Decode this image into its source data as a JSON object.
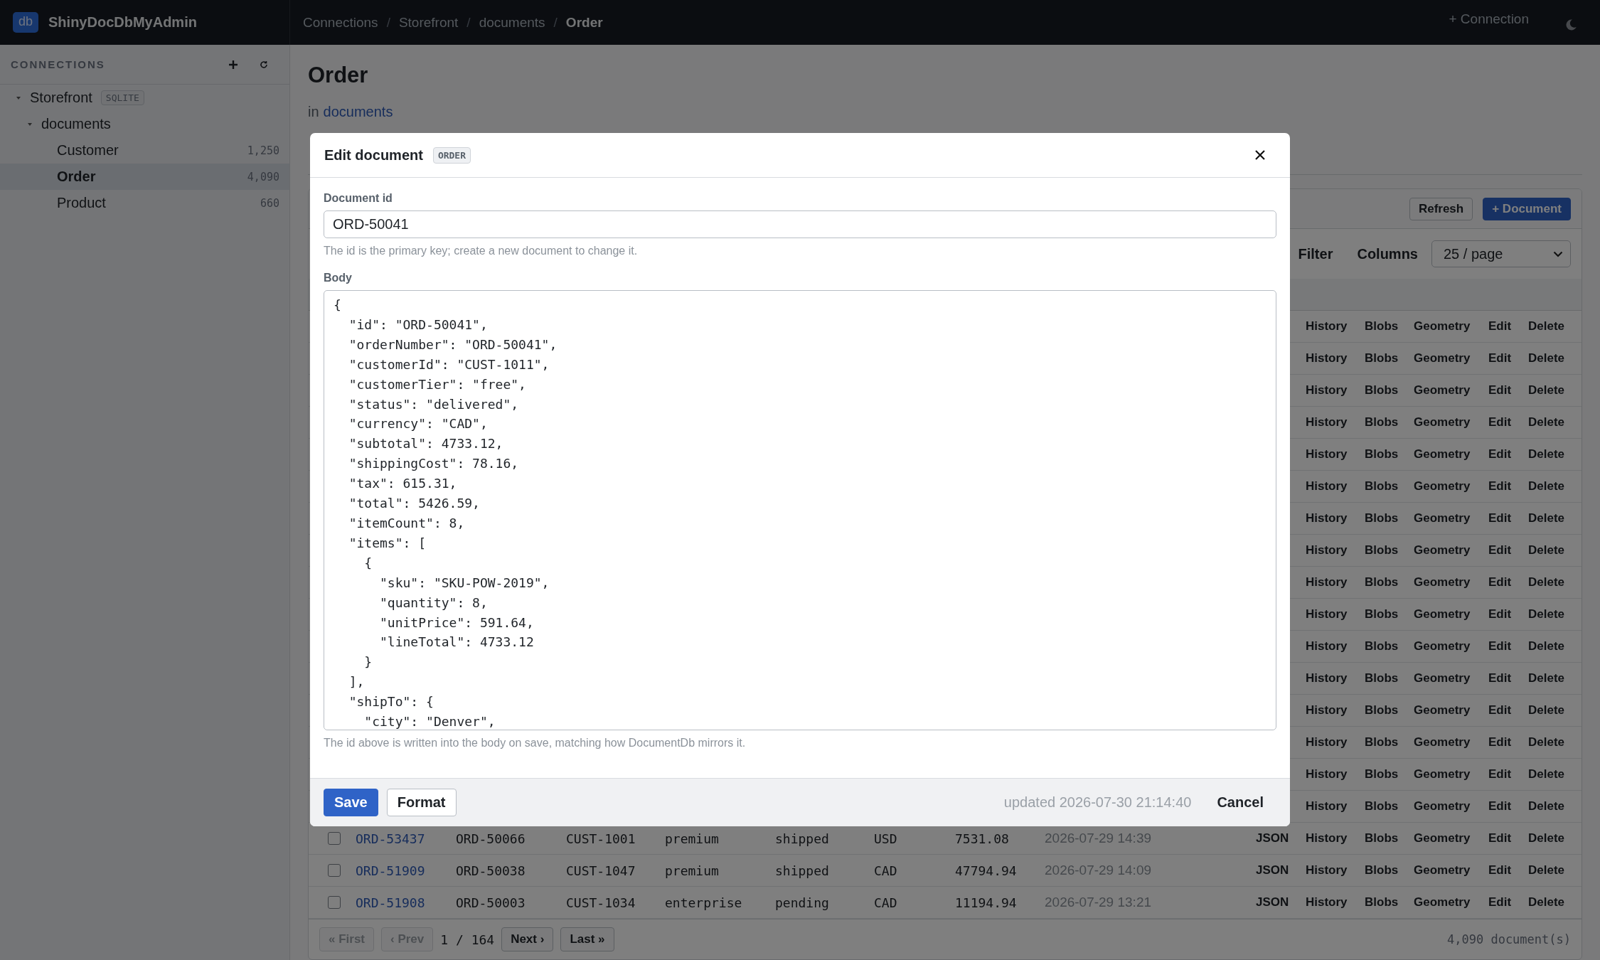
{
  "app": {
    "logo": "db",
    "name": "ShinyDocDbMyAdmin"
  },
  "breadcrumb": [
    {
      "label": "Connections",
      "current": false
    },
    {
      "label": "Storefront",
      "current": false
    },
    {
      "label": "documents",
      "current": false
    },
    {
      "label": "Order",
      "current": true
    }
  ],
  "breadcrumb_separator": "/",
  "topbar": {
    "new_connection": "+ Connection"
  },
  "sidebar": {
    "title": "CONNECTIONS",
    "tree": [
      {
        "name": "Storefront",
        "badge": "SQLITE",
        "expanded": true,
        "selected": false,
        "children": [
          {
            "name": "documents",
            "expanded": true,
            "selected": false,
            "children": [
              {
                "name": "Customer",
                "count": "1,250",
                "selected": false
              },
              {
                "name": "Order",
                "count": "4,090",
                "selected": true
              },
              {
                "name": "Product",
                "count": "660",
                "selected": false
              }
            ]
          }
        ]
      }
    ]
  },
  "page": {
    "title": "Order",
    "context_prefix": "in",
    "context_link": "documents"
  },
  "toolbar": {
    "buttons": [
      {
        "label": "Refresh",
        "kind": "secondary"
      },
      {
        "label": "+ Document",
        "kind": "primary"
      }
    ]
  },
  "filter_bar": {
    "filter": "Filter",
    "columns": "Columns",
    "page_size": "25 / page"
  },
  "table": {
    "rows": [
      {
        "actions": [
          "History",
          "Blobs",
          "Geometry",
          "Edit",
          "Delete"
        ]
      },
      {
        "actions": [
          "History",
          "Blobs",
          "Geometry",
          "Edit",
          "Delete"
        ]
      },
      {
        "actions": [
          "History",
          "Blobs",
          "Geometry",
          "Edit",
          "Delete"
        ]
      },
      {
        "actions": [
          "History",
          "Blobs",
          "Geometry",
          "Edit",
          "Delete"
        ]
      },
      {
        "actions": [
          "History",
          "Blobs",
          "Geometry",
          "Edit",
          "Delete"
        ]
      },
      {
        "actions": [
          "History",
          "Blobs",
          "Geometry",
          "Edit",
          "Delete"
        ]
      },
      {
        "actions": [
          "History",
          "Blobs",
          "Geometry",
          "Edit",
          "Delete"
        ]
      },
      {
        "actions": [
          "History",
          "Blobs",
          "Geometry",
          "Edit",
          "Delete"
        ]
      },
      {
        "actions": [
          "History",
          "Blobs",
          "Geometry",
          "Edit",
          "Delete"
        ]
      },
      {
        "actions": [
          "History",
          "Blobs",
          "Geometry",
          "Edit",
          "Delete"
        ]
      },
      {
        "actions": [
          "History",
          "Blobs",
          "Geometry",
          "Edit",
          "Delete"
        ]
      },
      {
        "actions": [
          "History",
          "Blobs",
          "Geometry",
          "Edit",
          "Delete"
        ]
      },
      {
        "actions": [
          "History",
          "Blobs",
          "Geometry",
          "Edit",
          "Delete"
        ]
      },
      {
        "actions": [
          "History",
          "Blobs",
          "Geometry",
          "Edit",
          "Delete"
        ]
      },
      {
        "actions": [
          "History",
          "Blobs",
          "Geometry",
          "Edit",
          "Delete"
        ]
      },
      {
        "actions": [
          "History",
          "Blobs",
          "Geometry",
          "Edit",
          "Delete"
        ]
      },
      {
        "checked": false,
        "cells": [
          "ORD-53437",
          "ORD-50066",
          "CUST-1001",
          "premium",
          "shipped",
          "USD",
          "7531.08",
          "2026-07-29 14:39"
        ],
        "actions": [
          "JSON",
          "History",
          "Blobs",
          "Geometry",
          "Edit",
          "Delete"
        ]
      },
      {
        "checked": false,
        "cells": [
          "ORD-51909",
          "ORD-50038",
          "CUST-1047",
          "premium",
          "shipped",
          "CAD",
          "47794.94",
          "2026-07-29 14:09"
        ],
        "actions": [
          "JSON",
          "History",
          "Blobs",
          "Geometry",
          "Edit",
          "Delete"
        ]
      },
      {
        "checked": false,
        "cells": [
          "ORD-51908",
          "ORD-50003",
          "CUST-1034",
          "enterprise",
          "pending",
          "CAD",
          "11194.94",
          "2026-07-29 13:21"
        ],
        "actions": [
          "JSON",
          "History",
          "Blobs",
          "Geometry",
          "Edit",
          "Delete"
        ]
      }
    ]
  },
  "pagination": {
    "controls": [
      {
        "kind": "button",
        "label": "« First",
        "disabled": true
      },
      {
        "kind": "button",
        "label": "‹ Prev",
        "disabled": true
      },
      {
        "kind": "text",
        "label": "1 / 164"
      },
      {
        "kind": "button",
        "label": "Next ›",
        "disabled": false
      },
      {
        "kind": "button",
        "label": "Last »",
        "disabled": false
      }
    ],
    "count": "4,090 document(s)"
  },
  "modal": {
    "title": "Edit document",
    "tag": "ORDER",
    "id_label": "Document id",
    "id_value": "ORD-50041",
    "id_help": "The id is the primary key; create a new document to change it.",
    "body_label": "Body",
    "body_value": "{\n  \"id\": \"ORD-50041\",\n  \"orderNumber\": \"ORD-50041\",\n  \"customerId\": \"CUST-1011\",\n  \"customerTier\": \"free\",\n  \"status\": \"delivered\",\n  \"currency\": \"CAD\",\n  \"subtotal\": 4733.12,\n  \"shippingCost\": 78.16,\n  \"tax\": 615.31,\n  \"total\": 5426.59,\n  \"itemCount\": 8,\n  \"items\": [\n    {\n      \"sku\": \"SKU-POW-2019\",\n      \"quantity\": 8,\n      \"unitPrice\": 591.64,\n      \"lineTotal\": 4733.12\n    }\n  ],\n  \"shipTo\": {\n    \"city\": \"Denver\",",
    "body_help": "The id above is written into the body on save, matching how DocumentDb mirrors it.",
    "actions": [
      {
        "label": "Save",
        "kind": "primary"
      },
      {
        "label": "Format",
        "kind": "secondary"
      }
    ],
    "updated": "updated 2026-07-30 21:14:40",
    "cancel": "Cancel"
  }
}
